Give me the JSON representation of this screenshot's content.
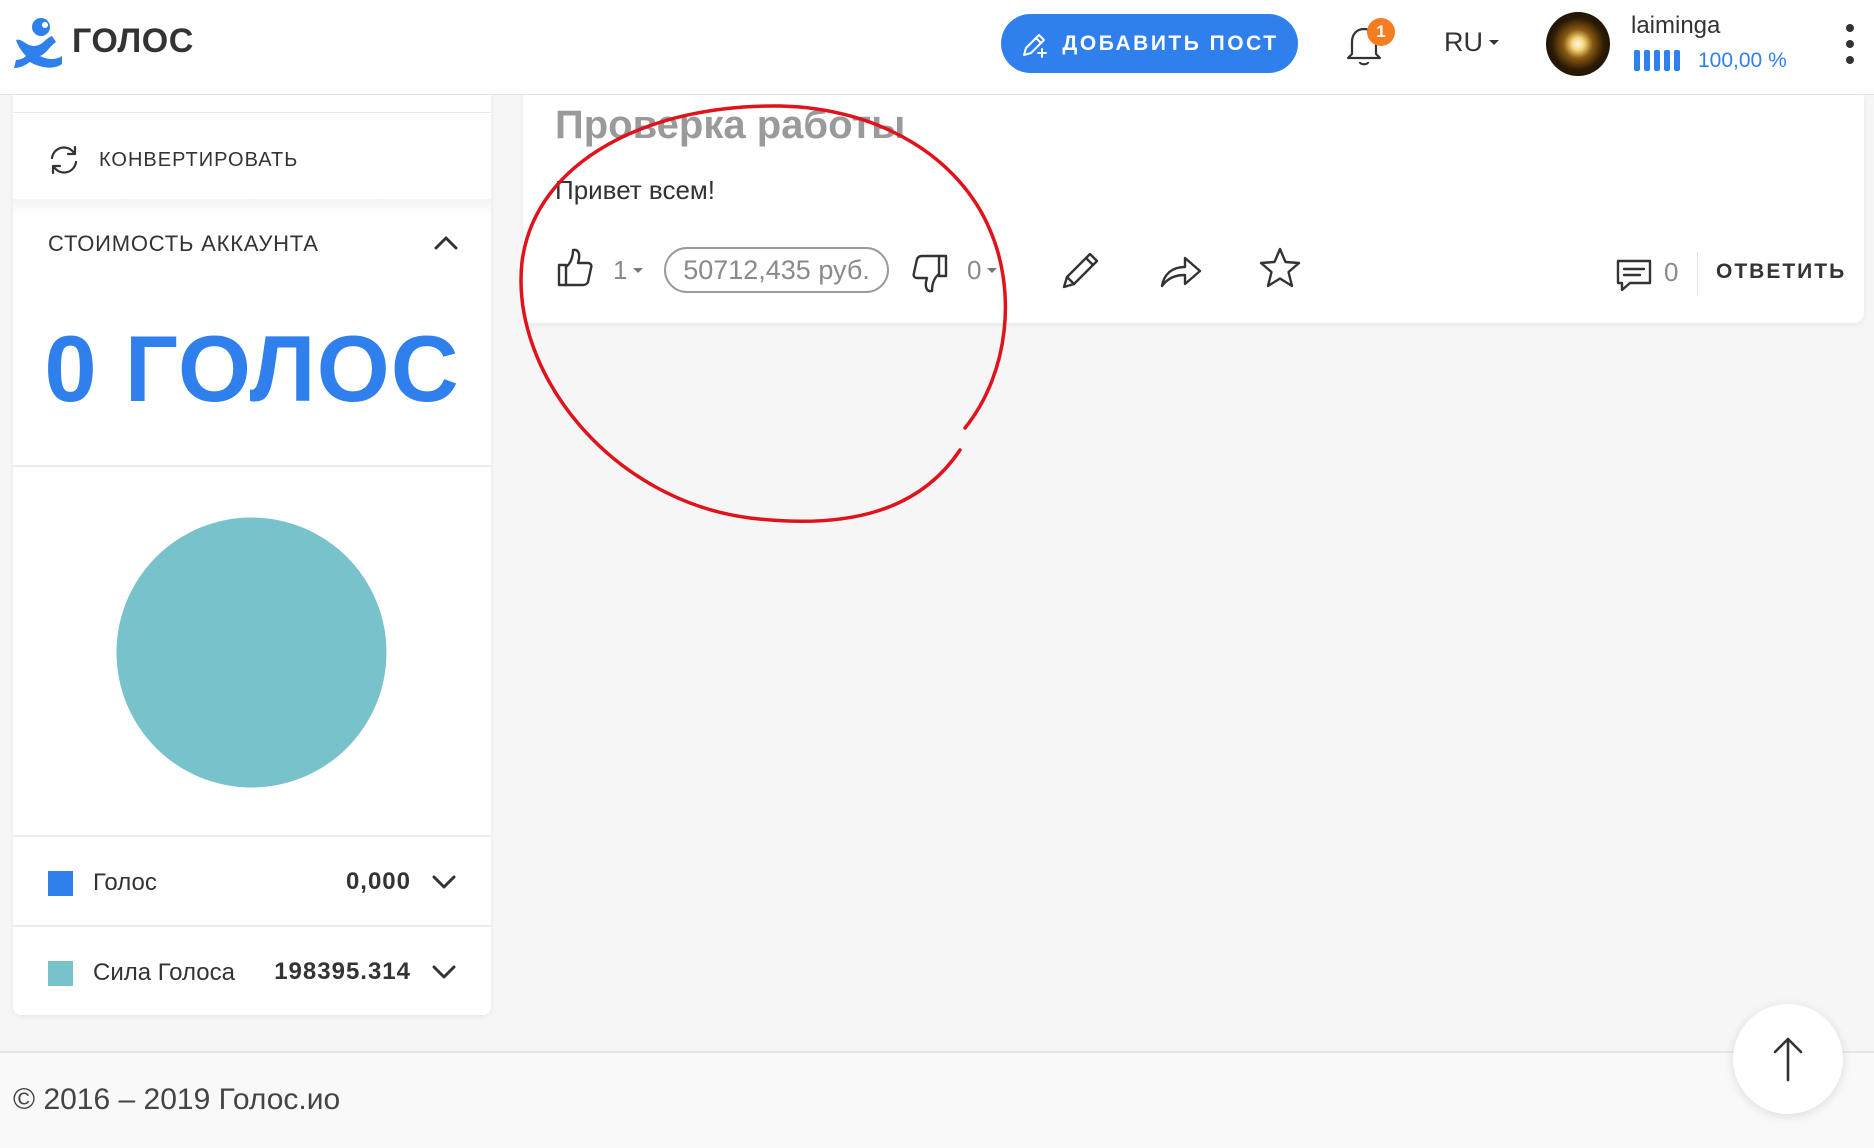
{
  "header": {
    "brand": "ГОЛОС",
    "add_post_label": "ДОБАВИТЬ ПОСТ",
    "notifications_count": "1",
    "language": "RU",
    "username": "laiminga",
    "voting_power": "100,00 %",
    "voting_power_fraction": 1.0
  },
  "sidebar": {
    "convert_label": "КОНВЕРТИРОВАТЬ",
    "section_title": "СТОИМОСТЬ АККАУНТА",
    "balance": "0 ГОЛОС",
    "legend": [
      {
        "name": "Голос",
        "value": "0,000",
        "color": "#2f80ed"
      },
      {
        "name": "Сила Голоса",
        "value": "198395.314",
        "color": "#78c2cc"
      }
    ]
  },
  "post": {
    "title": "Проверка работы",
    "body": "Привет всем!",
    "upvotes": "1",
    "payout": "50712,435 руб.",
    "downvotes": "0",
    "comments_count": "0",
    "reply_label": "ОТВЕТИТЬ"
  },
  "footer": {
    "copyright": "© 2016 – 2019 Голос.ио"
  },
  "colors": {
    "accent": "#2f80ed",
    "notification": "#f57c21",
    "pie": "#78c2cc",
    "annotation": "#e0121b"
  },
  "icons": [
    "golos-logo-icon",
    "pen-plus-icon",
    "bell-icon",
    "refresh-icon",
    "chevron-up-icon",
    "chevron-down-icon",
    "thumbs-up-icon",
    "thumbs-down-icon",
    "pencil-icon",
    "share-icon",
    "star-icon",
    "comment-icon",
    "arrow-up-icon",
    "more-vertical-icon"
  ]
}
